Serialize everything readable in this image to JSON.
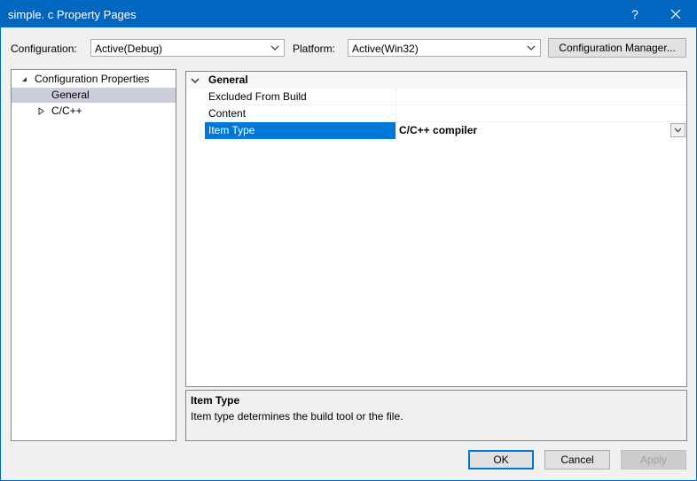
{
  "window": {
    "title": "simple. c Property Pages",
    "help_glyph": "?",
    "close_glyph": "✕"
  },
  "toolbar": {
    "configuration_label": "Configuration:",
    "configuration_value": "Active(Debug)",
    "platform_label": "Platform:",
    "platform_value": "Active(Win32)",
    "config_manager_label": "Configuration Manager..."
  },
  "tree": {
    "items": [
      {
        "label": "Configuration Properties",
        "expanded": true
      },
      {
        "label": "General",
        "selected": true
      },
      {
        "label": "C/C++",
        "expanded": false
      }
    ]
  },
  "grid": {
    "category": "General",
    "rows": [
      {
        "name": "Excluded From Build",
        "value": ""
      },
      {
        "name": "Content",
        "value": ""
      },
      {
        "name": "Item Type",
        "value": "C/C++ compiler",
        "selected": true
      }
    ]
  },
  "description": {
    "title": "Item Type",
    "text": "Item type determines the build tool or the file."
  },
  "buttons": {
    "ok": "OK",
    "cancel": "Cancel",
    "apply": "Apply"
  },
  "colors": {
    "title_bar": "#0067c0",
    "selection": "#0078d7",
    "tree_selection": "#cccedb"
  }
}
